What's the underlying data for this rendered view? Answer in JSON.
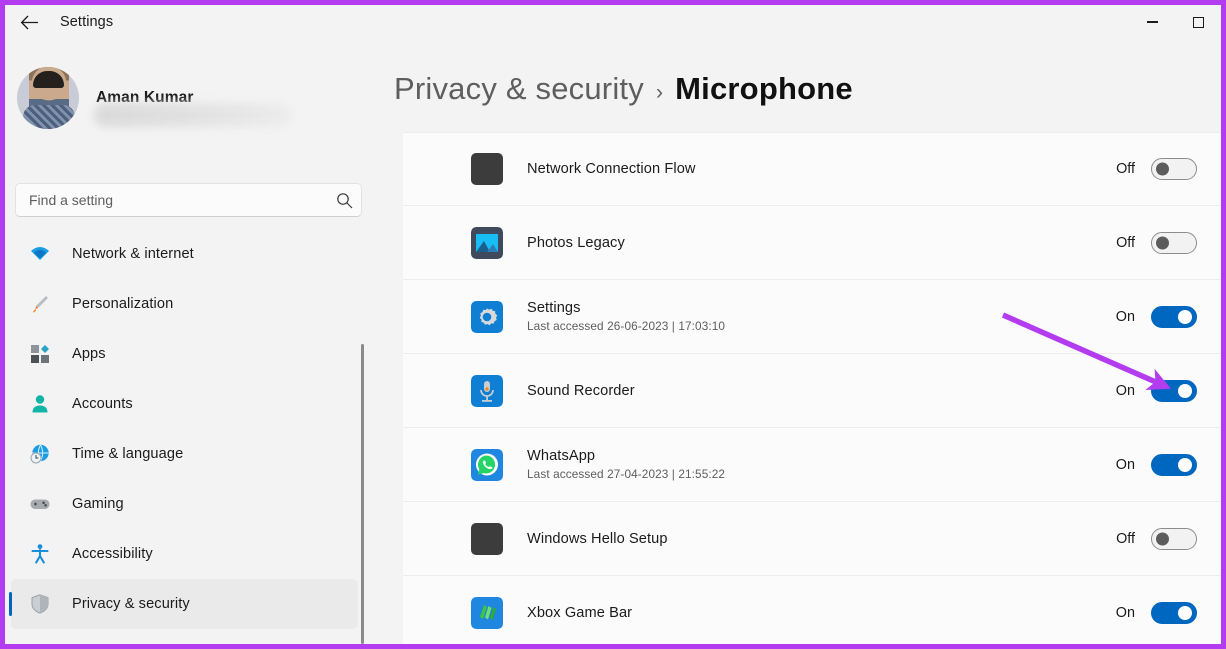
{
  "window": {
    "title": "Settings",
    "back_icon": "back-arrow-icon",
    "minimize_label": "",
    "maximize_label": "",
    "border_color": "#b33cf0"
  },
  "sidebar": {
    "profile": {
      "name": "Aman Kumar",
      "email_redacted": true
    },
    "search": {
      "placeholder": "Find a setting",
      "value": "",
      "icon": "search-icon"
    },
    "items": [
      {
        "label": "Network & internet",
        "icon": "wifi-icon",
        "selected": false
      },
      {
        "label": "Personalization",
        "icon": "paintbrush-icon",
        "selected": false
      },
      {
        "label": "Apps",
        "icon": "apps-icon",
        "selected": false
      },
      {
        "label": "Accounts",
        "icon": "person-icon",
        "selected": false
      },
      {
        "label": "Time & language",
        "icon": "globe-clock-icon",
        "selected": false
      },
      {
        "label": "Gaming",
        "icon": "gamepad-icon",
        "selected": false
      },
      {
        "label": "Accessibility",
        "icon": "accessibility-icon",
        "selected": false
      },
      {
        "label": "Privacy & security",
        "icon": "shield-icon",
        "selected": true
      }
    ]
  },
  "main": {
    "breadcrumb": {
      "parent": "Privacy & security",
      "separator": "›",
      "current": "Microphone"
    },
    "apps": [
      {
        "name": "Network Connection Flow",
        "last_accessed": "",
        "state_label": "Off",
        "state": "off",
        "icon": "generic-app-icon"
      },
      {
        "name": "Photos Legacy",
        "last_accessed": "",
        "state_label": "Off",
        "state": "off",
        "icon": "photos-icon"
      },
      {
        "name": "Settings",
        "last_accessed": "Last accessed 26-06-2023  |  17:03:10",
        "state_label": "On",
        "state": "on",
        "icon": "settings-gear-icon"
      },
      {
        "name": "Sound Recorder",
        "last_accessed": "",
        "state_label": "On",
        "state": "on",
        "icon": "microphone-icon",
        "annotated": true
      },
      {
        "name": "WhatsApp",
        "last_accessed": "Last accessed 27-04-2023  |  21:55:22",
        "state_label": "On",
        "state": "on",
        "icon": "whatsapp-icon"
      },
      {
        "name": "Windows Hello Setup",
        "last_accessed": "",
        "state_label": "Off",
        "state": "off",
        "icon": "generic-app-icon"
      },
      {
        "name": "Xbox Game Bar",
        "last_accessed": "",
        "state_label": "On",
        "state": "on",
        "icon": "xbox-game-bar-icon"
      }
    ]
  },
  "annotation": {
    "type": "arrow",
    "color": "#b33cf0",
    "points_at": "Sound Recorder toggle"
  },
  "colors": {
    "accent": "#0067c0",
    "annotation": "#b33cf0",
    "sidebar_bg": "#f3f3f3",
    "card_bg": "#fbfbfb"
  }
}
